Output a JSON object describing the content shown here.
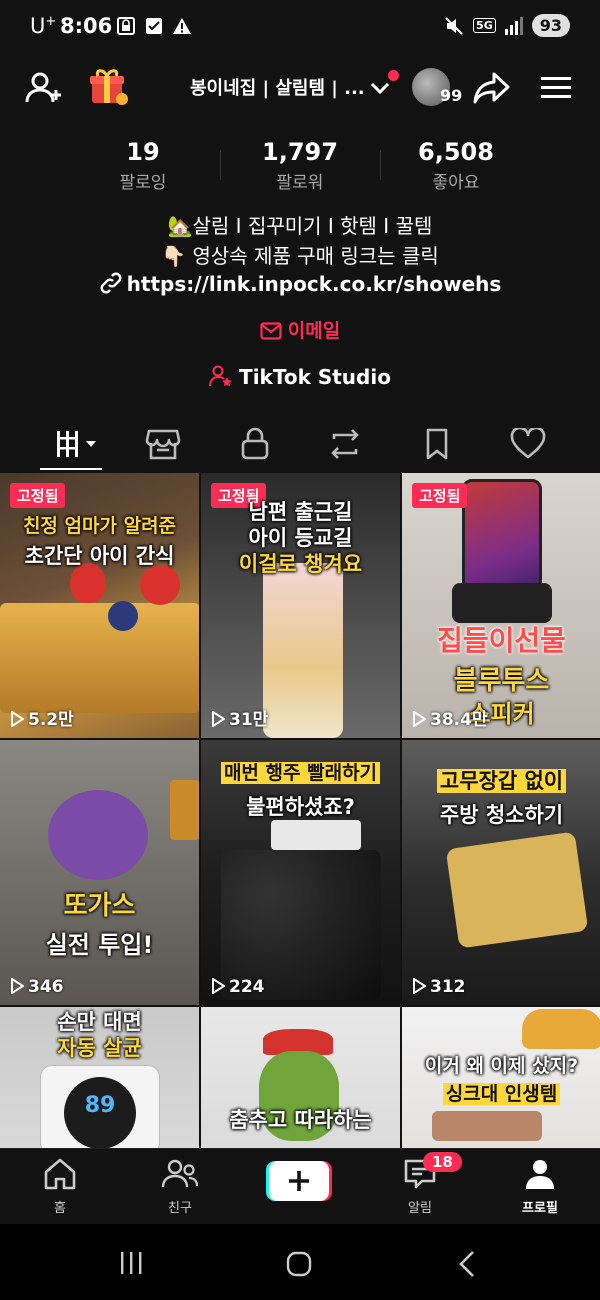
{
  "status": {
    "carrier": "U",
    "carrier_sup": "+",
    "time": "8:06",
    "network": "5G",
    "battery": "93"
  },
  "header": {
    "title": "봉이네집 | 살림템 | ...",
    "avatar_count": "99"
  },
  "stats": [
    {
      "value": "19",
      "label": "팔로잉"
    },
    {
      "value": "1,797",
      "label": "팔로워"
    },
    {
      "value": "6,508",
      "label": "좋아요"
    }
  ],
  "bio": {
    "line1": "🏡살림 I 집꾸미기 I 핫템 I 꿀템",
    "line2": "👇🏻 영상속 제품 구매 링크는 클릭",
    "link": "https://link.inpock.co.kr/showehs",
    "email_label": "이메일",
    "studio_label": "TikTok Studio"
  },
  "videos": [
    {
      "pinned": "고정됨",
      "caption1": "친정 엄마가 알려준",
      "caption2": "초간단 아이 간식",
      "views": "5.2만"
    },
    {
      "pinned": "고정됨",
      "caption1": "남편 출근길",
      "caption2": "아이 등교길",
      "caption3": "이걸로 챙겨요",
      "views": "31만"
    },
    {
      "pinned": "고정됨",
      "caption1": "집들이선물",
      "caption2": "블루투스",
      "caption3": "스피커",
      "views": "38.4만"
    },
    {
      "caption1": "또가스",
      "caption2": "실전 투입!",
      "views": "346"
    },
    {
      "caption1": "매번 행주 빨래하기",
      "caption2": "불편하셨죠?",
      "views": "224"
    },
    {
      "caption1": "고무장갑 없이",
      "caption2": "주방 청소하기",
      "views": "312"
    },
    {
      "caption1": "손만 대면",
      "caption2": "자동 살균",
      "display": "89"
    },
    {
      "caption1": "춤추고 따라하는"
    },
    {
      "caption1": "이거 왜 이제 샀지?",
      "caption2": "싱크대 인생템"
    }
  ],
  "bottom_nav": {
    "home": "홈",
    "friends": "친구",
    "inbox": "알림",
    "inbox_badge": "18",
    "profile": "프로필"
  },
  "colors": {
    "accent": "#fe2c55",
    "caption_yellow": "#ffd73a",
    "background": "#121212"
  }
}
